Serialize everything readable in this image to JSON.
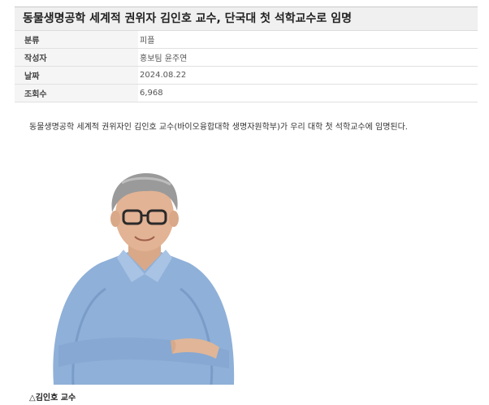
{
  "article": {
    "title": "동물생명공학 세계적 권위자 김인호 교수, 단국대 첫 석학교수로 임명",
    "meta": [
      {
        "label": "분류",
        "value": "피플"
      },
      {
        "label": "작성자",
        "value": "홍보팀 윤주연"
      },
      {
        "label": "날짜",
        "value": "2024.08.22"
      },
      {
        "label": "조회수",
        "value": "6,968"
      }
    ],
    "summary": "동물생명공학 세계적 권위자인 김인호 교수(바이오융합대학 생명자원학부)가 우리 대학 첫 석학교수에 임명된다.",
    "photo_caption": "△김인호 교수"
  }
}
